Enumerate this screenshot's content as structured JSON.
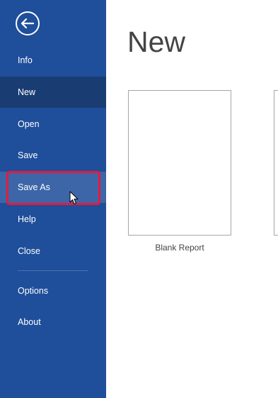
{
  "sidebar": {
    "back_icon": "back-arrow-icon",
    "items": [
      {
        "label": "Info",
        "state": "normal"
      },
      {
        "label": "New",
        "state": "selected"
      },
      {
        "label": "Open",
        "state": "normal"
      },
      {
        "label": "Save",
        "state": "normal"
      },
      {
        "label": "Save As",
        "state": "hovered"
      },
      {
        "label": "Help",
        "state": "normal"
      },
      {
        "label": "Close",
        "state": "normal"
      },
      {
        "label": "Options",
        "state": "normal"
      },
      {
        "label": "About",
        "state": "normal"
      }
    ]
  },
  "main": {
    "title": "New",
    "templates": [
      {
        "label": "Blank Report"
      }
    ]
  },
  "colors": {
    "sidebar_bg": "#1f4e9a",
    "selected_bg": "#193d73",
    "hover_bg": "#3d66a8",
    "highlight": "#e31b3e"
  }
}
